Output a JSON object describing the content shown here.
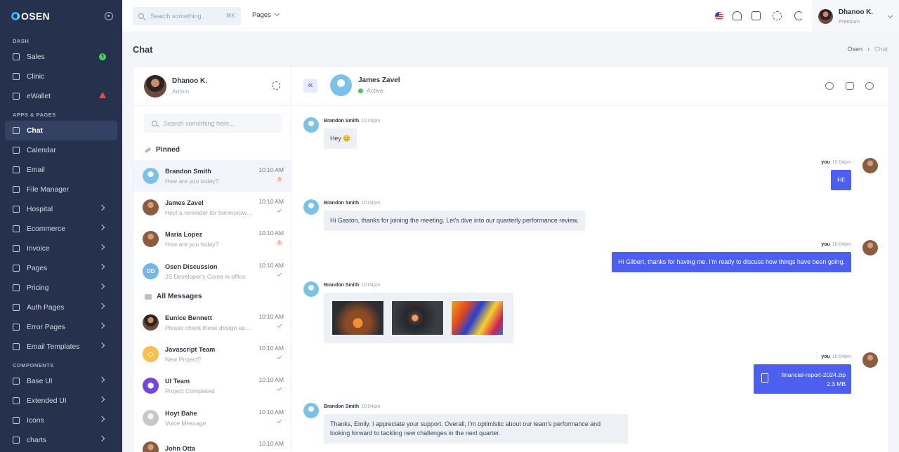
{
  "brand": "OSEN",
  "sidebar": {
    "sections": [
      "DASH",
      "APPS & PAGES",
      "COMPONENTS"
    ],
    "dash": [
      {
        "label": "Sales",
        "badge": "5"
      },
      {
        "label": "Clinic"
      },
      {
        "label": "eWallet"
      }
    ],
    "apps": [
      "Chat",
      "Calendar",
      "Email",
      "File Manager",
      "Hospital",
      "Ecommerce",
      "Invoice",
      "Pages",
      "Pricing",
      "Auth Pages",
      "Error Pages",
      "Email Templates"
    ],
    "components": [
      "Base UI",
      "Extended UI",
      "Icons",
      "charts"
    ]
  },
  "topbar": {
    "search_placeholder": "Search something..",
    "shortcut": "⌘K",
    "pages_menu": "Pages",
    "user_name": "Dhanoo K.",
    "user_plan": "Premium"
  },
  "page": {
    "title": "Chat",
    "breadcrumb": [
      "Osen",
      "Chat"
    ]
  },
  "contacts": {
    "me_name": "Dhanoo K.",
    "me_role": "Admin",
    "search_placeholder": "Search something here...",
    "pinned_label": "Pinned",
    "all_label": "All Messages",
    "pinned": [
      {
        "name": "Brandon Smith",
        "preview": "How are you today?",
        "time": "10:10 AM",
        "unread": "3"
      },
      {
        "name": "James Zavel",
        "preview": "Hey! a reminder for tommorow's meeting",
        "time": "10:10 AM"
      },
      {
        "name": "Maria Lopez",
        "preview": "How are you today?",
        "time": "10:10 AM",
        "unread": "1"
      },
      {
        "name": "Osen Discussion",
        "initials": "OD",
        "preview": "JS Developer's Come in office",
        "time": "10:10 AM"
      }
    ],
    "all": [
      {
        "name": "Eunice Bennett",
        "preview": "Please check these design assets",
        "time": "10:10 AM"
      },
      {
        "name": "Javascript Team",
        "preview": "New Project?",
        "time": "10:10 AM"
      },
      {
        "name": "UI Team",
        "preview": "Project Completed",
        "time": "10:10 AM"
      },
      {
        "name": "Hoyt Bahe",
        "preview": "Voice Message",
        "time": "10:10 AM"
      },
      {
        "name": "John Otta",
        "preview": "",
        "time": "10:10 AM"
      }
    ]
  },
  "chat": {
    "peer_name": "James Zavel",
    "peer_status": "Active",
    "messages": [
      {
        "sender": "Brandon Smith",
        "time": "10:04pm",
        "text": "Hey 😊"
      },
      {
        "sender": "you",
        "time": "10:04pm",
        "text": "Hi!"
      },
      {
        "sender": "Brandon Smith",
        "time": "10:04pm",
        "text": "Hi Gaston, thanks for joining the meeting. Let's dive into our quarterly performance review."
      },
      {
        "sender": "you",
        "time": "10:04pm",
        "text": "Hi Gilbert, thanks for having me. I'm ready to discuss how things have been going."
      },
      {
        "sender": "Brandon Smith",
        "time": "10:04pm"
      },
      {
        "sender": "you",
        "time": "10:04pm",
        "file_name": "financial-report-2024.zip",
        "file_size": "2.3 MB"
      },
      {
        "sender": "Brandon Smith",
        "time": "10:04pm",
        "text": "Thanks, Emily. I appreciate your support. Overall, I'm optimistic about our team's performance and looking forward to tackling new challenges in the next quarter."
      }
    ]
  }
}
